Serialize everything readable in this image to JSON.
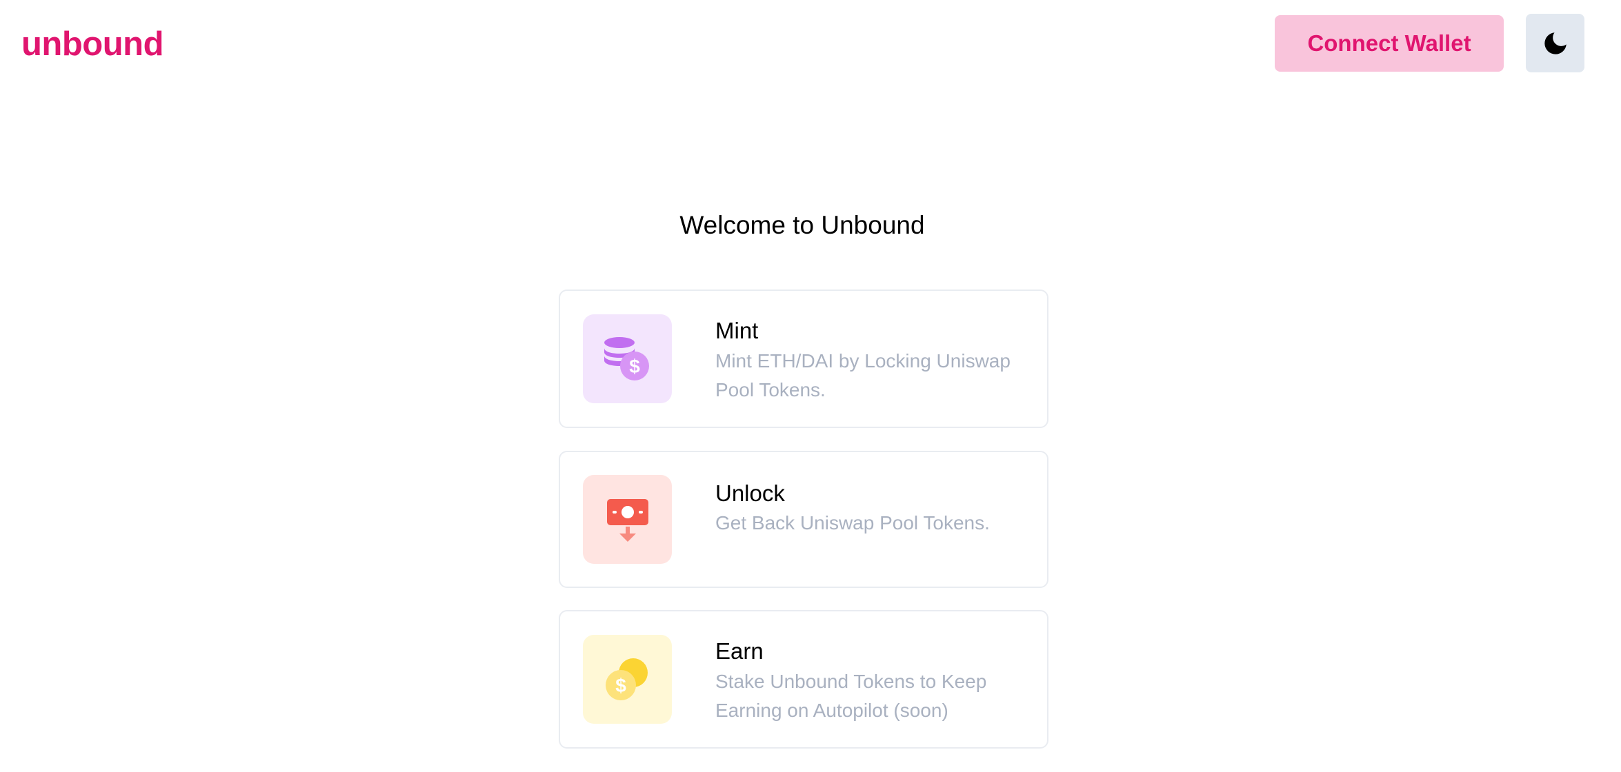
{
  "header": {
    "logo": "unbound",
    "connect_label": "Connect Wallet",
    "theme_icon": "moon-icon"
  },
  "main": {
    "welcome": "Welcome to Unbound",
    "cards": [
      {
        "title": "Mint",
        "description": "Mint ETH/DAI by Locking Uniswap Pool Tokens.",
        "icon": "coins-stack-icon",
        "icon_bg": "#f3e5fd",
        "icon_color": "#c16ef0"
      },
      {
        "title": "Unlock",
        "description": "Get Back Uniswap Pool Tokens.",
        "icon": "cash-withdraw-icon",
        "icon_bg": "#ffe4e1",
        "icon_color": "#f45b4d"
      },
      {
        "title": "Earn",
        "description": "Stake Unbound Tokens to Keep Earning on Autopilot (soon)",
        "icon": "coins-icon",
        "icon_bg": "#fff8d6",
        "icon_color": "#fbd433"
      }
    ]
  },
  "colors": {
    "brand": "#e0156f",
    "connect_bg": "#f9c4db",
    "theme_btn_bg": "#e2e8f0",
    "muted_text": "#a9b1c0",
    "card_border": "#e9ecf1"
  }
}
